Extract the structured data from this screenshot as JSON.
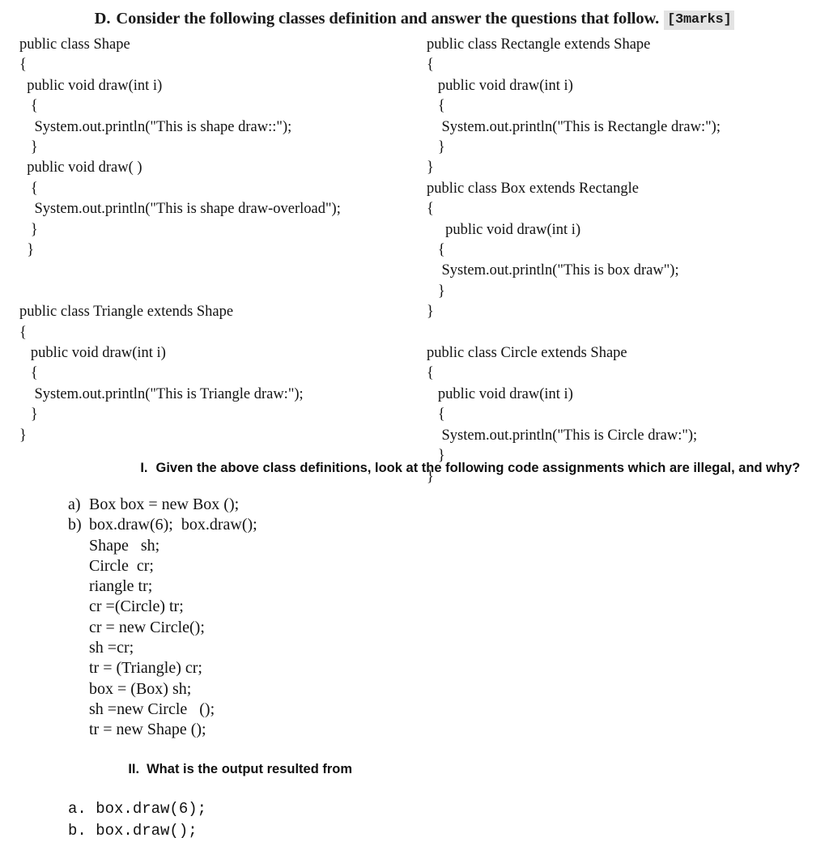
{
  "header": {
    "label": "D.",
    "title": "Consider the following classes definition and answer the questions that follow.",
    "marks_badge": "[3marks]",
    "badge_bg": "#e3e3e3"
  },
  "code_columns": {
    "left": [
      {
        "name": "shape-class",
        "lines": [
          "public class Shape",
          "{",
          "  public void draw(int i)",
          "   {",
          "    System.out.println(\"This is shape draw::\");",
          "   }",
          "  public void draw( )",
          "   {",
          "    System.out.println(\"This is shape draw-overload\");",
          "   }",
          "  }"
        ]
      },
      {
        "name": "triangle-class",
        "lines": [
          "public class Triangle extends Shape",
          "{",
          "   public void draw(int i)",
          "   {",
          "    System.out.println(\"This is Triangle draw:\");",
          "   }",
          "}"
        ]
      }
    ],
    "right": [
      {
        "name": "rectangle-class",
        "lines": [
          "public class Rectangle extends Shape",
          "{",
          "   public void draw(int i)",
          "   {",
          "    System.out.println(\"This is Rectangle draw:\");",
          "   }",
          "}"
        ]
      },
      {
        "name": "box-class",
        "lines": [
          "public class Box extends Rectangle",
          "{",
          "     public void draw(int i)",
          "   {",
          "    System.out.println(\"This is box draw\");",
          "   }",
          "}"
        ]
      },
      {
        "name": "circle-class",
        "lines": [
          "public class Circle extends Shape",
          "{",
          "   public void draw(int i)",
          "   {",
          "    System.out.println(\"This is Circle draw:\");",
          "   }",
          "}"
        ]
      }
    ]
  },
  "question_one": {
    "numeral": "I.",
    "text": "Given the above class definitions, look at the following code assignments which are illegal, and why?",
    "items": [
      {
        "marker": "a)",
        "code": "Box box = new Box ();"
      },
      {
        "marker": "b)",
        "code": "box.draw(6);  box.draw();"
      },
      {
        "marker": "",
        "code": "Shape   sh;"
      },
      {
        "marker": "",
        "code": "Circle  cr;"
      },
      {
        "marker": "",
        "code": "riangle tr;"
      },
      {
        "marker": "",
        "code": "cr =(Circle) tr;"
      },
      {
        "marker": "",
        "code": "cr = new Circle();"
      },
      {
        "marker": "",
        "code": "sh =cr;"
      },
      {
        "marker": "",
        "code": "tr = (Triangle) cr;"
      },
      {
        "marker": "",
        "code": "box = (Box) sh;"
      },
      {
        "marker": "",
        "code": "sh =new Circle   ();"
      },
      {
        "marker": "",
        "code": "tr = new Shape ();"
      }
    ]
  },
  "question_two": {
    "numeral": "II.",
    "text": "What is the output resulted from",
    "items": [
      "a. box.draw(6);",
      "b. box.draw();"
    ]
  }
}
